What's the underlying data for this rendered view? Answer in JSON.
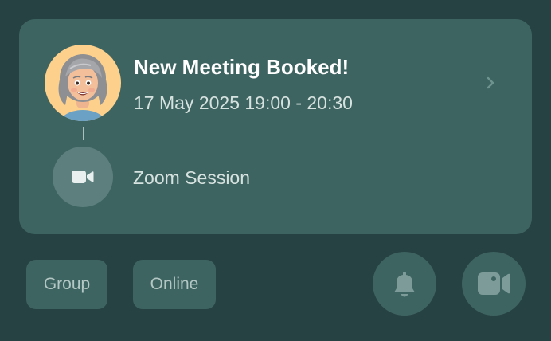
{
  "notification": {
    "title": "New Meeting Booked!",
    "datetime": "17 May 2025 19:00 - 20:30",
    "session_label": "Zoom Session",
    "avatar_icon": "memoji-avatar",
    "chevron_icon": "chevron-right-icon",
    "session_icon": "video-camera-icon"
  },
  "tags": [
    {
      "label": "Group"
    },
    {
      "label": "Online"
    }
  ],
  "actions": {
    "bell_icon": "bell-icon",
    "video_icon": "video-camera-icon"
  },
  "colors": {
    "background": "#264242",
    "card": "#3e6461",
    "avatar_bg": "#fdd08b",
    "title": "#ffffff",
    "muted_text": "#d6e2df"
  }
}
